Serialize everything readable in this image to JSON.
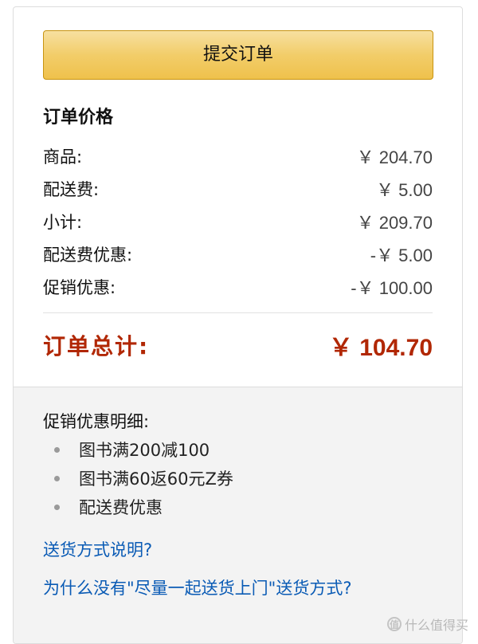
{
  "submit_button": {
    "label": "提交订单"
  },
  "order_price": {
    "title": "订单价格",
    "rows": [
      {
        "label": "商品:",
        "value": "￥ 204.70"
      },
      {
        "label": "配送费:",
        "value": "￥ 5.00"
      },
      {
        "label": "小计:",
        "value": "￥ 209.70"
      },
      {
        "label": "配送费优惠:",
        "value": "-￥ 5.00"
      },
      {
        "label": "促销优惠:",
        "value": "-￥ 100.00"
      }
    ],
    "total": {
      "label": "订单总计:",
      "value": "￥ 104.70"
    }
  },
  "promo_details": {
    "title": "促销优惠明细:",
    "items": [
      "图书满200减100",
      "图书满60返60元Z券",
      "配送费优惠"
    ]
  },
  "links": {
    "delivery_info": "送货方式说明?",
    "why_not_combined": "为什么没有\"尽量一起送货上门\"送货方式?"
  },
  "watermark": {
    "text": "什么值得买",
    "icon": "值"
  },
  "colors": {
    "total_red": "#b12704",
    "link_blue": "#0a5bb5",
    "button_gold": "#f2cd69"
  }
}
